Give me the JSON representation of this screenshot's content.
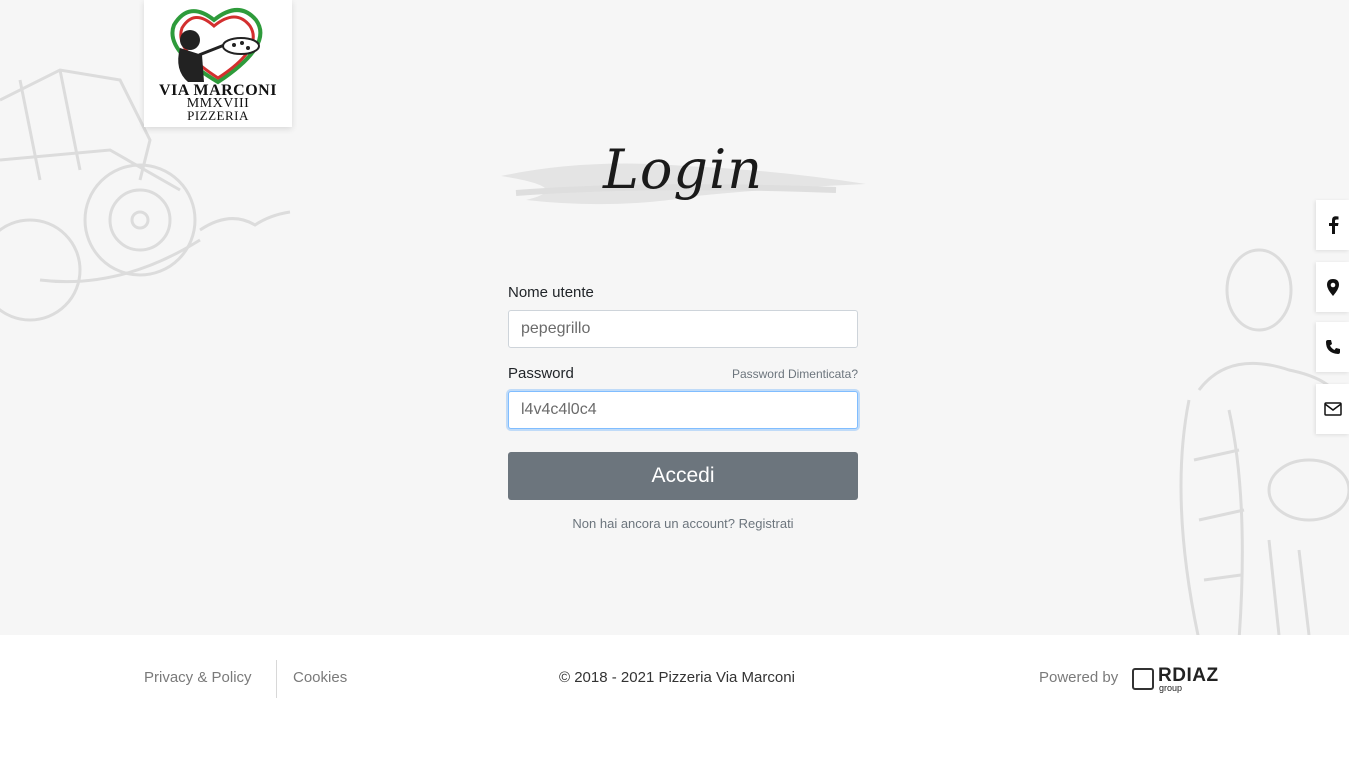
{
  "logo": {
    "line1": "VIA MARCONI",
    "line2": "MMXVIII",
    "line3": "PIZZERIA"
  },
  "title": "Login",
  "form": {
    "username_label": "Nome utente",
    "username_value": "pepegrillo",
    "password_label": "Password",
    "forgot_link": "Password Dimenticata?",
    "password_value": "l4v4c4l0c4",
    "submit_label": "Accedi",
    "register_prompt": "Non hai ancora un account?",
    "register_link": "Registrati"
  },
  "side_buttons": [
    {
      "icon": "facebook-icon"
    },
    {
      "icon": "map-pin-icon"
    },
    {
      "icon": "phone-icon"
    },
    {
      "icon": "envelope-icon"
    }
  ],
  "footer": {
    "privacy_link": "Privacy & Policy",
    "cookies_link": "Cookies",
    "copyright": "© 2018 - 2021 Pizzeria Via Marconi",
    "powered_by": "Powered by",
    "brand_name": "RDIAZ",
    "brand_sub": "group"
  },
  "colors": {
    "hero_background": "#f6f6f6",
    "button": "#6c757d",
    "focus_border": "#80bdff",
    "logo_green": "#2e9b3b",
    "logo_red": "#d32f2f"
  }
}
